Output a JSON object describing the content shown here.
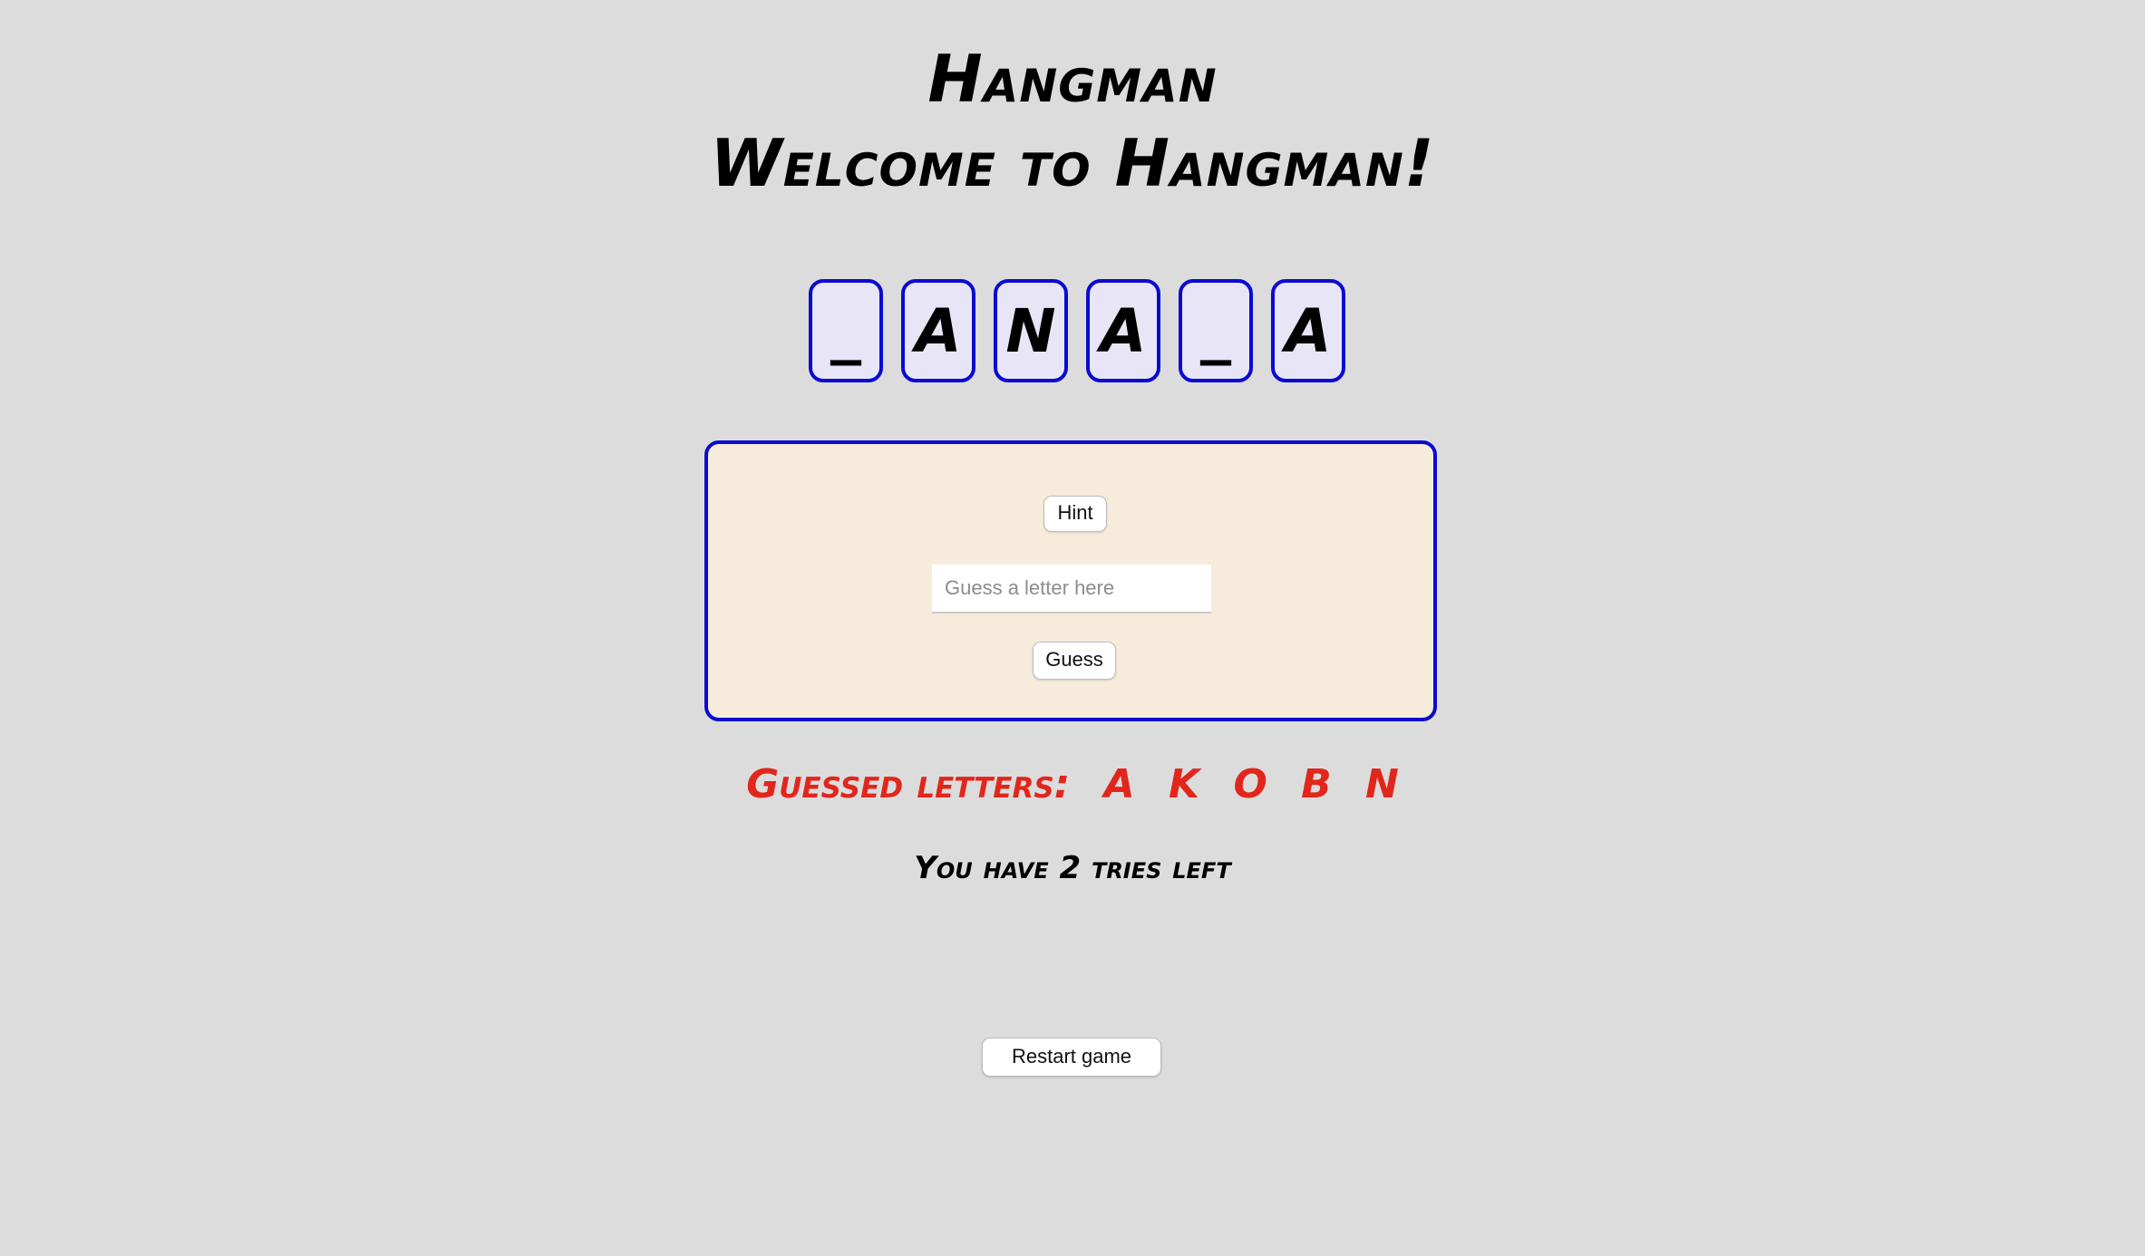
{
  "header": {
    "title": "Hangman",
    "subtitle": "Welcome to Hangman!"
  },
  "word": {
    "tiles": [
      "_",
      "A",
      "N",
      "A",
      "_",
      "A"
    ]
  },
  "controls": {
    "hint_label": "Hint",
    "guess_placeholder": "Guess a letter here",
    "guess_value": "",
    "guess_label": "Guess"
  },
  "status": {
    "guessed_label": "Guessed letters:",
    "guessed_letters": [
      "A",
      "K",
      "O",
      "B",
      "N"
    ],
    "tries_text": "You have 2 tries left"
  },
  "footer": {
    "restart_label": "Restart game"
  },
  "colors": {
    "background": "#dcdcdc",
    "tile_border": "#0a0ad2",
    "tile_fill": "#e8e6f6",
    "panel_fill": "#f7ecdc",
    "guessed_text": "#e1261c"
  }
}
